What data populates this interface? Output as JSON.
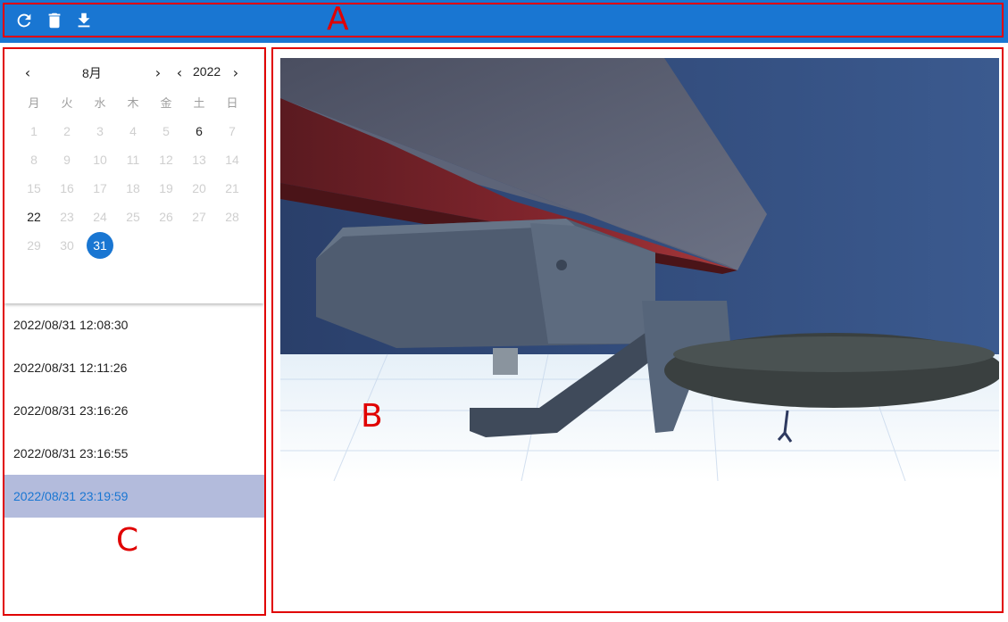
{
  "toolbar": {
    "buttons": [
      {
        "name": "refresh",
        "icon": "refresh-icon"
      },
      {
        "name": "delete",
        "icon": "trash-icon"
      },
      {
        "name": "download",
        "icon": "download-icon"
      }
    ],
    "marker": "A",
    "color": "#1976d2"
  },
  "calendar": {
    "month": "8月",
    "year": "2022",
    "weekdays": [
      "月",
      "火",
      "水",
      "木",
      "金",
      "土",
      "日"
    ],
    "days": [
      "1",
      "2",
      "3",
      "4",
      "5",
      "6",
      "7",
      "8",
      "9",
      "10",
      "11",
      "12",
      "13",
      "14",
      "15",
      "16",
      "17",
      "18",
      "19",
      "20",
      "21",
      "22",
      "23",
      "24",
      "25",
      "26",
      "27",
      "28",
      "29",
      "30",
      "31"
    ],
    "enabled_days": [
      "6",
      "22",
      "31"
    ],
    "selected_day": "31"
  },
  "records": {
    "items": [
      "2022/08/31 12:08:30",
      "2022/08/31 12:11:26",
      "2022/08/31 23:16:26",
      "2022/08/31 23:16:55",
      "2022/08/31 23:19:59"
    ],
    "active_index": 4,
    "marker": "C"
  },
  "viewer": {
    "marker": "B"
  }
}
